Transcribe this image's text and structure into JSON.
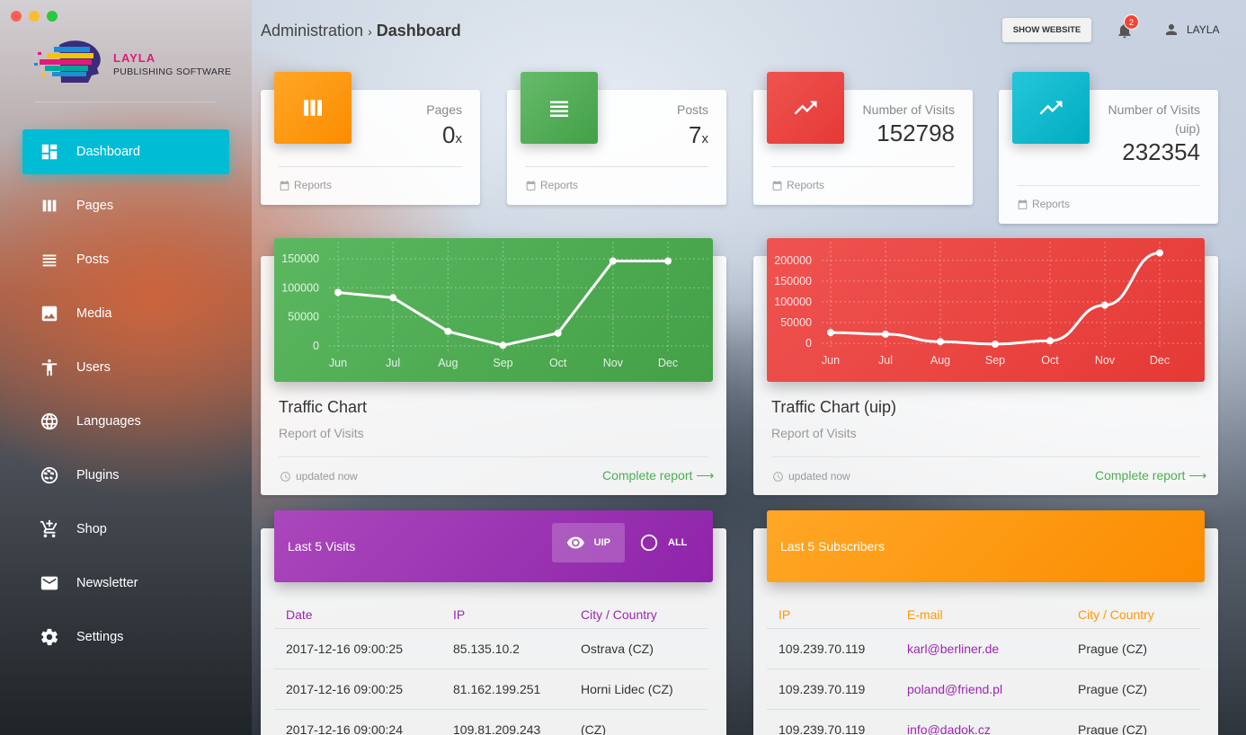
{
  "app": {
    "brand_title": "LAYLA",
    "brand_subtitle": "PUBLISHING SOFTWARE"
  },
  "sidebar": {
    "items": [
      {
        "label": "Dashboard",
        "icon": "dashboard-icon",
        "active": true
      },
      {
        "label": "Pages",
        "icon": "columns-icon"
      },
      {
        "label": "Posts",
        "icon": "list-icon"
      },
      {
        "label": "Media",
        "icon": "image-icon"
      },
      {
        "label": "Users",
        "icon": "person-icon"
      },
      {
        "label": "Languages",
        "icon": "globe-icon"
      },
      {
        "label": "Plugins",
        "icon": "plugin-icon"
      },
      {
        "label": "Shop",
        "icon": "cart-icon"
      },
      {
        "label": "Newsletter",
        "icon": "mail-icon"
      },
      {
        "label": "Settings",
        "icon": "gear-icon"
      }
    ]
  },
  "header": {
    "crumb_root": "Administration",
    "crumb_sep": "›",
    "crumb_current": "Dashboard",
    "show_website": "SHOW WEBSITE",
    "notification_count": "2",
    "user_name": "LAYLA"
  },
  "stats": [
    {
      "label": "Pages",
      "value": "0",
      "suffix": "x",
      "footer": "Reports",
      "color": "#ff9800",
      "icon": "columns-icon"
    },
    {
      "label": "Posts",
      "value": "7",
      "suffix": "x",
      "footer": "Reports",
      "color": "#4caf50",
      "icon": "list-icon"
    },
    {
      "label": "Number of Visits",
      "value": "152798",
      "suffix": "",
      "footer": "Reports",
      "color": "#f44336",
      "icon": "trending-up-icon"
    },
    {
      "label": "Number of Visits (uip)",
      "value": "232354",
      "suffix": "",
      "footer": "Reports",
      "color": "#00bcd4",
      "icon": "trending-up-icon"
    }
  ],
  "charts": [
    {
      "title": "Traffic Chart",
      "subtitle": "Report of Visits",
      "updated": "updated now",
      "link": "Complete report ⟶",
      "color": "#4caf50"
    },
    {
      "title": "Traffic Chart (uip)",
      "subtitle": "Report of Visits",
      "updated": "updated now",
      "link": "Complete report ⟶",
      "color": "#f44336"
    }
  ],
  "chart_data": [
    {
      "type": "line",
      "categories": [
        "Jun",
        "Jul",
        "Aug",
        "Sep",
        "Oct",
        "Nov",
        "Dec"
      ],
      "values": [
        92000,
        83000,
        25000,
        1000,
        22000,
        146000,
        146000
      ],
      "yticks": [
        0,
        50000,
        100000,
        150000
      ],
      "ylim": [
        0,
        170000
      ],
      "title": "Traffic Chart"
    },
    {
      "type": "line",
      "categories": [
        "Jun",
        "Jul",
        "Aug",
        "Sep",
        "Oct",
        "Nov",
        "Dec"
      ],
      "values": [
        26000,
        22000,
        4000,
        -2000,
        6000,
        92000,
        218000
      ],
      "yticks": [
        0,
        50000,
        100000,
        150000,
        200000
      ],
      "ylim": [
        -15000,
        232000
      ],
      "title": "Traffic Chart (uip)"
    }
  ],
  "visits": {
    "title": "Last 5 Visits",
    "toggle_uip": "UIP",
    "toggle_all": "ALL",
    "columns": [
      "Date",
      "IP",
      "City / Country"
    ],
    "rows": [
      [
        "2017-12-16 09:00:25",
        "85.135.10.2",
        "Ostrava (CZ)"
      ],
      [
        "2017-12-16 09:00:25",
        "81.162.199.251",
        "Horni Lidec (CZ)"
      ],
      [
        "2017-12-16 09:00:24",
        "109.81.209.243",
        "(CZ)"
      ]
    ],
    "color": "#9c27b0"
  },
  "subscribers": {
    "title": "Last 5 Subscribers",
    "columns": [
      "IP",
      "E-mail",
      "City / Country"
    ],
    "rows": [
      [
        "109.239.70.119",
        "karl@berliner.de",
        "Prague (CZ)"
      ],
      [
        "109.239.70.119",
        "poland@friend.pl",
        "Prague (CZ)"
      ],
      [
        "109.239.70.119",
        "info@dadok.cz",
        "Prague (CZ)"
      ]
    ],
    "color": "#ff9800"
  }
}
